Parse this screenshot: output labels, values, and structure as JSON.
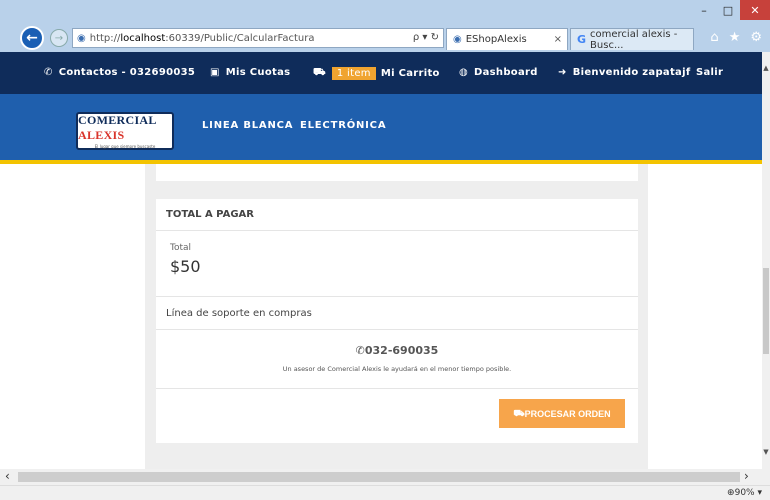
{
  "browser": {
    "address_prefix": "http://",
    "address_host": "localhost",
    "address_rest": ":60339/Public/CalcularFactura",
    "address_tools": "ρ ▾ ↻",
    "tabs": [
      {
        "label": "EShopAlexis"
      },
      {
        "label": "comercial alexis - Busc..."
      }
    ],
    "zoom": "90%"
  },
  "topbar": {
    "contacts": "Contactos - 032690035",
    "quotas": "Mis Cuotas",
    "cart_badge": "1 item",
    "cart": "Mi Carrito",
    "dashboard": "Dashboard",
    "welcome": "Bienvenido zapatajf",
    "logout": "Salir"
  },
  "header": {
    "logo_c": "C",
    "logo_omercial": "OMERCIAL",
    "logo_alexis": "ALEXIS",
    "logo_tagline": "El lugar que siempre buscaste",
    "menu": [
      "LINEA BLANCA",
      "ELECTRÓNICA"
    ]
  },
  "summary": {
    "heading": "TOTAL A PAGAR",
    "total_label": "Total",
    "total_value": "$50",
    "support_label": "Línea de soporte en compras",
    "phone": "032-690035",
    "advisor_text": "Un asesor de Comercial Alexis le ayudará en el menor tiempo posible.",
    "process_button": "PROCESAR ORDEN"
  },
  "colors": {
    "topbar": "#0f2c5a",
    "header": "#1f5fad",
    "accent_yellow": "#f3c300",
    "button_orange": "#f7a54b"
  }
}
